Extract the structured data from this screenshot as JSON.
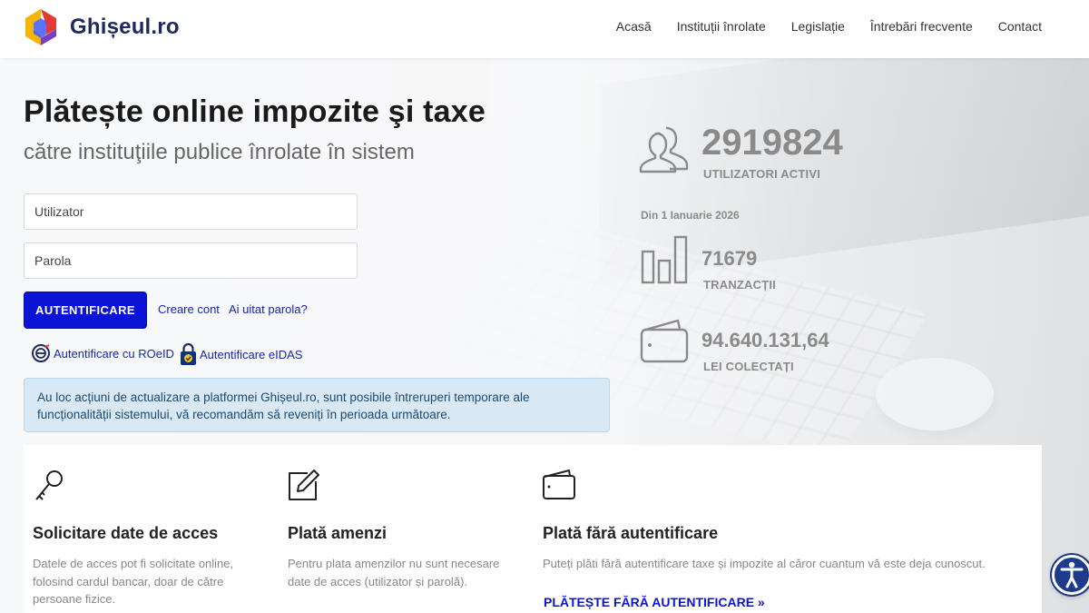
{
  "brand": {
    "name": "Ghișeul.ro"
  },
  "nav": {
    "items": [
      "Acasă",
      "Instituții înrolate",
      "Legislație",
      "Întrebări frecvente",
      "Contact"
    ]
  },
  "hero": {
    "title": "Plătește online impozite şi taxe",
    "subtitle": "către instituţiile publice înrolate în sistem"
  },
  "login": {
    "username_placeholder": "Utilizator",
    "password_placeholder": "Parola",
    "submit_label": "AUTENTIFICARE",
    "create_account": "Creare cont",
    "forgot_password": "Ai uitat parola?",
    "roeid_label": "Autentificare cu ROeID",
    "eidas_label": "Autentificare eIDAS"
  },
  "notice": "Au loc acțiuni de actualizare a platformei Ghișeul.ro, sunt posibile întreruperi temporare ale funcționalității sistemului, vă recomandăm să reveniți în perioada următoare.",
  "stats": {
    "users_value": "2919824",
    "users_label": "UTILIZATORI ACTIVI",
    "since": "Din 1 Ianuarie 2026",
    "transactions_value": "71679",
    "transactions_label": "TRANZACȚII",
    "collected_value": "94.640.131,64",
    "collected_label": "LEI COLECTAȚI"
  },
  "cards": [
    {
      "title": "Solicitare date de acces",
      "text": "Datele de acces pot fi solicitate online, folosind cardul bancar, doar de către persoane fizice."
    },
    {
      "title": "Plată amenzi",
      "text": "Pentru plata amenzilor nu sunt necesare date de acces (utilizator și parolă)."
    },
    {
      "title": "Plată fără autentificare",
      "text": "Puteți plăti fără autentificare taxe și impozite al căror cuantum vă este deja cunoscut.",
      "link": "PLĂTEȘTE FĂRĂ AUTENTIFICARE »"
    }
  ],
  "colors": {
    "primary": "#0a13d6",
    "brand_text": "#1d2a5b",
    "notice_bg": "#d8e8f4",
    "stat_gray": "#8a8a8a"
  }
}
